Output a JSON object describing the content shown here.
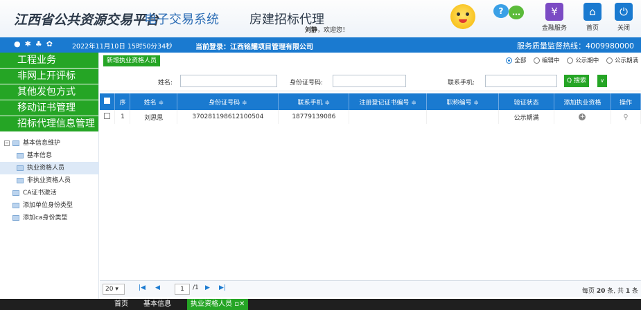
{
  "header": {
    "title_main": "江西省公共资源交易平台",
    "title_sub": "电子交易系统",
    "title_sys": "房建招标代理",
    "welcome_user": "刘静",
    "welcome_text": "，欢迎您！",
    "buttons": [
      {
        "label": "金融服务",
        "icon": "finance-icon",
        "color": "#7b4bc4"
      },
      {
        "label": "首页",
        "icon": "home-icon",
        "color": "#1a7ad0"
      },
      {
        "label": "关闭",
        "icon": "power-icon",
        "color": "#1a7ad0"
      }
    ]
  },
  "statusbar": {
    "time": "2022年11月10日 15时50分34秒",
    "login_label": "当前登录：",
    "login_company": "江西铭耀项目管理有限公司",
    "hotline": "服务质量监督热线：4009980000"
  },
  "nav": {
    "buttons": [
      "工程业务",
      "非网上开评标",
      "其他发包方式",
      "移动证书管理",
      "招标代理信息管理"
    ],
    "tree": {
      "root": "基本信息维护",
      "children": [
        "基本信息",
        "执业资格人员",
        "非执业资格人员"
      ],
      "others": [
        "CA证书激活",
        "添加单位身份类型",
        "添加ca身份类型"
      ]
    }
  },
  "toolbar": {
    "add_label": "新增执业资格人员",
    "radios": [
      "全部",
      "编辑中",
      "公示期中",
      "公示期满"
    ],
    "selected_radio": "全部"
  },
  "search": {
    "name_label": "姓名:",
    "id_label": "身份证号码:",
    "phone_label": "联系手机:",
    "search_label": "Q 搜索"
  },
  "table": {
    "columns": [
      "序",
      "姓名 ≑",
      "身份证号码 ≑",
      "联系手机 ≑",
      "注册登记证书编号 ≑",
      "职称编号 ≑",
      "验证状态",
      "添加执业资格",
      "操作"
    ],
    "rows": [
      {
        "index": "1",
        "name": "刘思思",
        "id": "370281198612100504",
        "phone": "18779139086",
        "cert": "",
        "title": "",
        "status": "公示期满"
      }
    ]
  },
  "pager": {
    "page_size": "20",
    "page": "1",
    "total_pages": "/1",
    "info_prefix": "每页 ",
    "info_size": "20",
    "info_mid": " 条, 共 ",
    "info_total": "1",
    "info_suffix": " 条"
  },
  "tabs": [
    "首页",
    "基本信息",
    "执业资格人员"
  ]
}
